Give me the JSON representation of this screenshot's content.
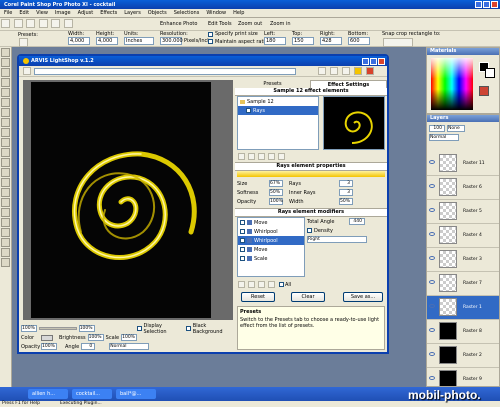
{
  "app": {
    "title": "Corel Paint Shop Pro Photo XI - cocktail",
    "menu": [
      "File",
      "Edit",
      "View",
      "Image",
      "Adjust",
      "Effects",
      "Layers",
      "Objects",
      "Selections",
      "Window",
      "Help"
    ]
  },
  "toolbar": {
    "buttons": [
      "Enhance Photo",
      "Edit Tools",
      "Zoom out",
      "Zoom in"
    ],
    "presets_label": "Presets:",
    "width_label": "Width:",
    "width_value": "4,000",
    "height_label": "Height:",
    "height_value": "4,000",
    "units_label": "Units:",
    "units_value": "Inches",
    "resolution_label": "Resolution:",
    "resolution_value": "300.000",
    "resolution_unit": "Pixels/Inch",
    "specify_print_size": "Specify print size",
    "maintain_aspect": "Maintain aspect ratio",
    "left_label": "Left:",
    "left_value": "180",
    "top_label": "Top:",
    "top_value": "150",
    "right_label": "Right:",
    "right_value": "428",
    "bottom_label": "Bottom:",
    "bottom_value": "600",
    "snap_label": "Snap crop rectangle to:"
  },
  "panels": {
    "materials": "Materials",
    "layers": "Layers",
    "opacity_value": "100",
    "blend_value": "Normal",
    "none_label": "None",
    "layers_list": [
      "Raster 11",
      "Raster 6",
      "Raster 5",
      "Raster 4",
      "Raster 3",
      "Raster 7",
      "Raster 1",
      "Raster 8",
      "Raster 2",
      "Raster 9"
    ]
  },
  "dialog": {
    "title": "ARVIS LightShop v.1.2",
    "tabs": [
      "Presets",
      "Effect Settings"
    ],
    "sample_header": "Sample 12 effect elements",
    "tree_root": "Sample 12",
    "tree_child": "Rays",
    "element_props_header": "Rays element properties",
    "size_label": "Size",
    "size_value": "67%",
    "rays_label": "Rays",
    "rays_value": "3",
    "softness_label": "Softness",
    "softness_value": "50%",
    "inner_rays_label": "Inner Rays",
    "inner_rays_value": "3",
    "opacity_label": "Opacity",
    "opacity_value": "100%",
    "width_label": "Width",
    "width_value": "50%",
    "modifiers_header": "Rays element modifiers",
    "modifiers": [
      "Move",
      "Whirlpool",
      "Whirlpool",
      "Move",
      "Scale"
    ],
    "total_angle_label": "Total Angle",
    "total_angle_value": "440",
    "density_label": "Density",
    "direction_value": "Right",
    "all_label": "All",
    "reset_button": "Reset",
    "clear_button": "Clear",
    "saveas_button": "Save as...",
    "presets_info_title": "Presets",
    "presets_info_text": "Switch to the Presets tab to choose a ready-to-use light effect from the list of presets.",
    "zoom_value": "100%",
    "zoom_right_value": "100%",
    "display_selection": "Display Selection",
    "black_background": "Black Background",
    "color_label": "Color",
    "brightness_label": "Brightness",
    "brightness_value": "100%",
    "scale_label": "Scale",
    "scale_value": "100%",
    "opacity2_label": "Opacity",
    "opacity2_value": "100%",
    "angle_label": "Angle",
    "angle_value": "0",
    "mode_value": "Normal"
  },
  "taskbar": {
    "items": [
      "allien h...",
      "cocktail...",
      "ball*@..."
    ],
    "status_left": "Press F1 for Help",
    "status_mid": "Executing Plugin..."
  },
  "watermark": "mobil-photo."
}
